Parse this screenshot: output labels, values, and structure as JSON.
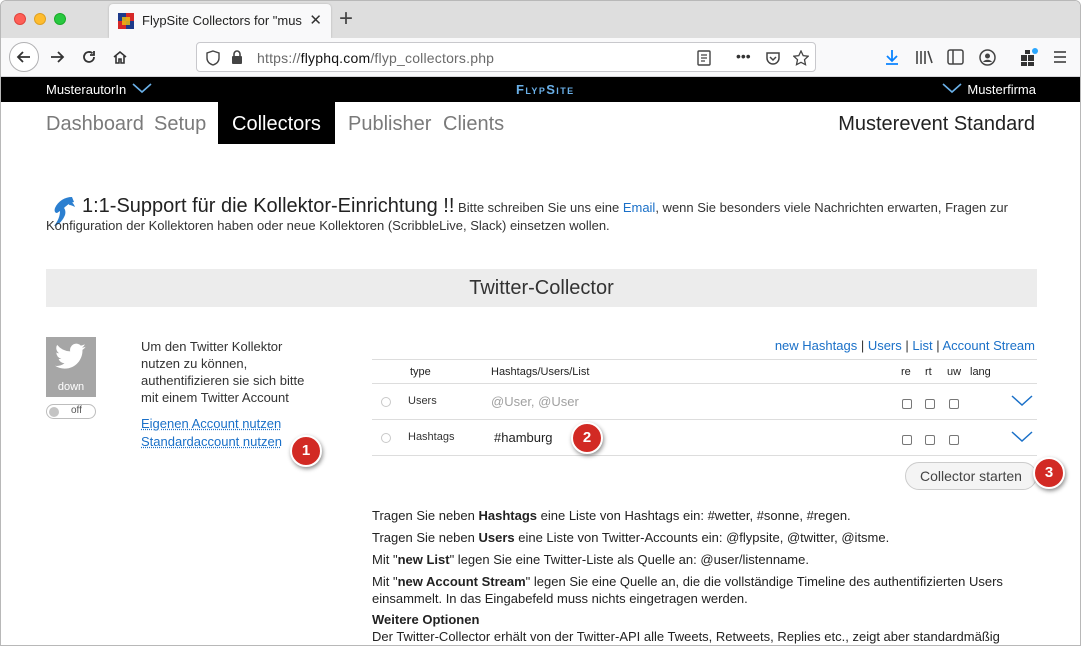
{
  "browser": {
    "tab_title": "FlypSite Collectors for \"musterf",
    "url_prefix": "https://",
    "url_domain": "flyphq.com",
    "url_path": "/flyp_collectors.php",
    "page_actions_label": "•••"
  },
  "site": {
    "author": "MusterautorIn",
    "brand": "FlypSite",
    "company": "Musterfirma",
    "nav": [
      {
        "label": "Dashboard"
      },
      {
        "label": "Setup"
      },
      {
        "label": "Collectors"
      },
      {
        "label": "Publisher"
      },
      {
        "label": "Clients"
      }
    ],
    "event": "Musterevent Standard"
  },
  "support": {
    "headline": "1:1-Support für die Kollektor-Einrichtung !!",
    "text_before": " Bitte schreiben Sie uns eine ",
    "email_link": "Email",
    "text_after": ", wenn Sie besonders viele Nachrichten erwarten, Fragen zur Konfiguration der Kollektoren haben oder neue Kollektoren (ScribbleLive, Slack) einsetzen wollen."
  },
  "collector": {
    "title": "Twitter-Collector",
    "status": "down",
    "toggle_label": "off",
    "info": "Um den Twitter Kollektor nutzen zu können, authentifizieren sie sich bitte mit einem Twitter Account",
    "own_account": "Eigenen Account nutzen",
    "default_account": "Standardaccount nutzen",
    "modes": {
      "hashtags": "new Hashtags",
      "users": "Users",
      "list": "List",
      "stream": "Account Stream",
      "separator": " | "
    },
    "columns": {
      "type": "type",
      "value": "Hashtags/Users/List",
      "re": "re",
      "rt": "rt",
      "uw": "uw",
      "lang": "lang"
    },
    "rows": [
      {
        "type": "Users",
        "value": "",
        "placeholder": "@User, @User"
      },
      {
        "type": "Hashtags",
        "value": "#hamburg",
        "placeholder": ""
      }
    ],
    "start_button": "Collector starten"
  },
  "badges": {
    "one": "1",
    "two": "2",
    "three": "3"
  },
  "help": {
    "l1_pre": "Tragen Sie neben ",
    "l1_bold": "Hashtags",
    "l1_post": " eine Liste von Hashtags ein: #wetter, #sonne, #regen.",
    "l2_pre": "Tragen Sie neben ",
    "l2_bold": "Users",
    "l2_post": " eine Liste von Twitter-Accounts ein: @flypsite, @twitter, @itsme.",
    "l3_pre": "Mit \"",
    "l3_bold": "new List",
    "l3_post": "\" legen Sie eine Twitter-Liste als Quelle an: @user/listenname.",
    "l4_pre": "Mit \"",
    "l4_bold": "new Account Stream",
    "l4_post": "\" legen Sie eine Quelle an, die die vollständige Timeline des authentifizierten Users einsammelt. In das Eingabefeld muss nichts eingetragen werden.",
    "more_title": "Weitere Optionen",
    "more_text": "Der Twitter-Collector erhält von der Twitter-API alle Tweets, Retweets, Replies etc., zeigt aber standardmäßig"
  }
}
